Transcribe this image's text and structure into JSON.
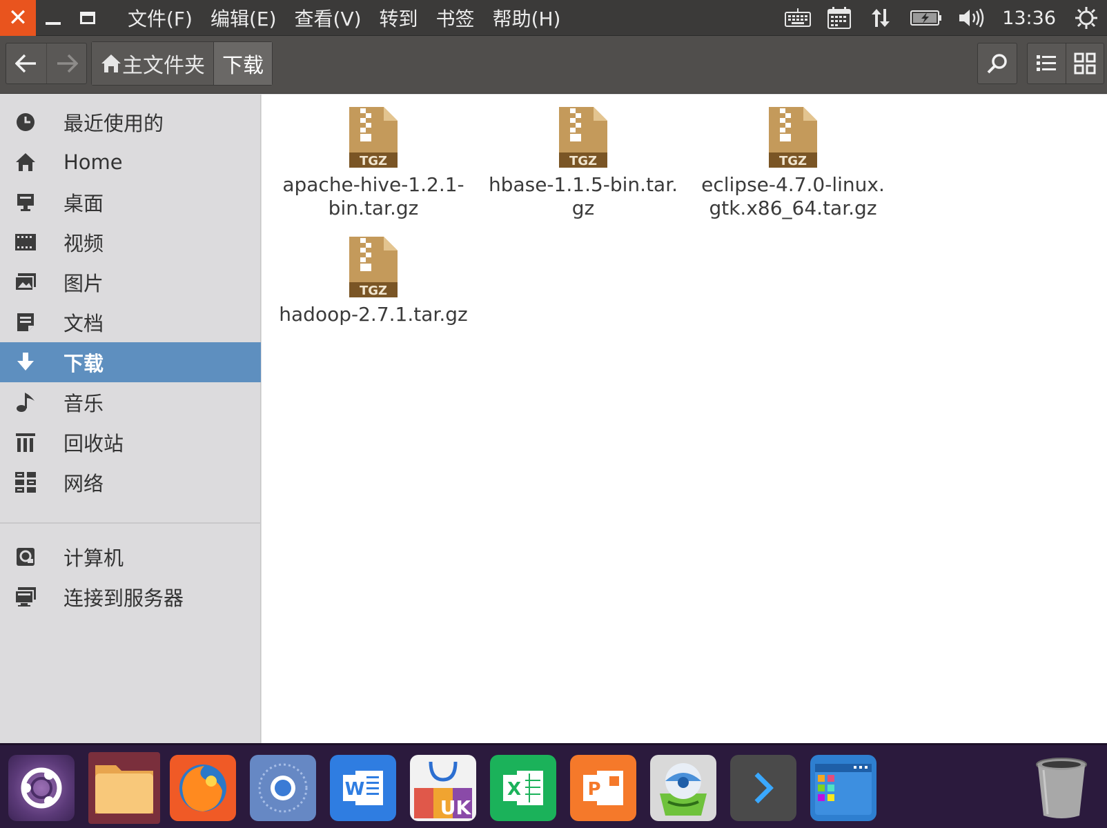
{
  "menubar": {
    "menus": [
      "文件(F)",
      "编辑(E)",
      "查看(V)",
      "转到",
      "书签",
      "帮助(H)"
    ],
    "clock": "13:36",
    "indicators": [
      "keyboard-icon",
      "calendar-icon",
      "network-updown-icon",
      "battery-icon",
      "volume-icon",
      "power-icon"
    ]
  },
  "toolbar": {
    "crumbs": [
      "主文件夹",
      "下载"
    ]
  },
  "sidebar": {
    "items": [
      {
        "label": "最近使用的",
        "icon": "recent-clock-icon"
      },
      {
        "label": "Home",
        "icon": "home-icon"
      },
      {
        "label": "桌面",
        "icon": "desktop-icon"
      },
      {
        "label": "视频",
        "icon": "video-icon"
      },
      {
        "label": "图片",
        "icon": "pictures-icon"
      },
      {
        "label": "文档",
        "icon": "documents-icon"
      },
      {
        "label": "下载",
        "icon": "download-icon"
      },
      {
        "label": "音乐",
        "icon": "music-icon"
      },
      {
        "label": "回收站",
        "icon": "trash-icon"
      },
      {
        "label": "网络",
        "icon": "network-icon"
      },
      {
        "label": "计算机",
        "icon": "computer-icon"
      },
      {
        "label": "连接到服务器",
        "icon": "server-icon"
      }
    ],
    "selected": "下载"
  },
  "files": [
    {
      "line1": "apache-hive-1.2.1-",
      "line2": "bin.tar.gz",
      "type": "TGZ"
    },
    {
      "line1": "hbase-1.1.5-bin.tar.",
      "line2": "gz",
      "type": "TGZ"
    },
    {
      "line1": "eclipse-4.7.0-linux.",
      "line2": "gtk.x86_64.tar.gz",
      "type": "TGZ"
    },
    {
      "line1": "hadoop-2.7.1.tar.gz",
      "line2": "",
      "type": "TGZ"
    }
  ],
  "dock": {
    "apps": [
      "ubuntu-logo-icon",
      "files-app-icon",
      "firefox-icon",
      "chromium-icon",
      "wps-writer-icon",
      "ubuntu-kylin-store-icon",
      "wps-spreadsheet-icon",
      "wps-presentation-icon",
      "software-updater-icon",
      "terminal-icon",
      "workspace-switcher-icon",
      "trash-dock-icon"
    ],
    "labels": {
      "writer": "W",
      "kylin": "UK",
      "excel": "X",
      "ppt": "P"
    }
  },
  "colors": {
    "accent": "#5e8fbf",
    "close": "#e9541e",
    "archive": "#c49a5b",
    "dock": "#2b1a3d"
  }
}
